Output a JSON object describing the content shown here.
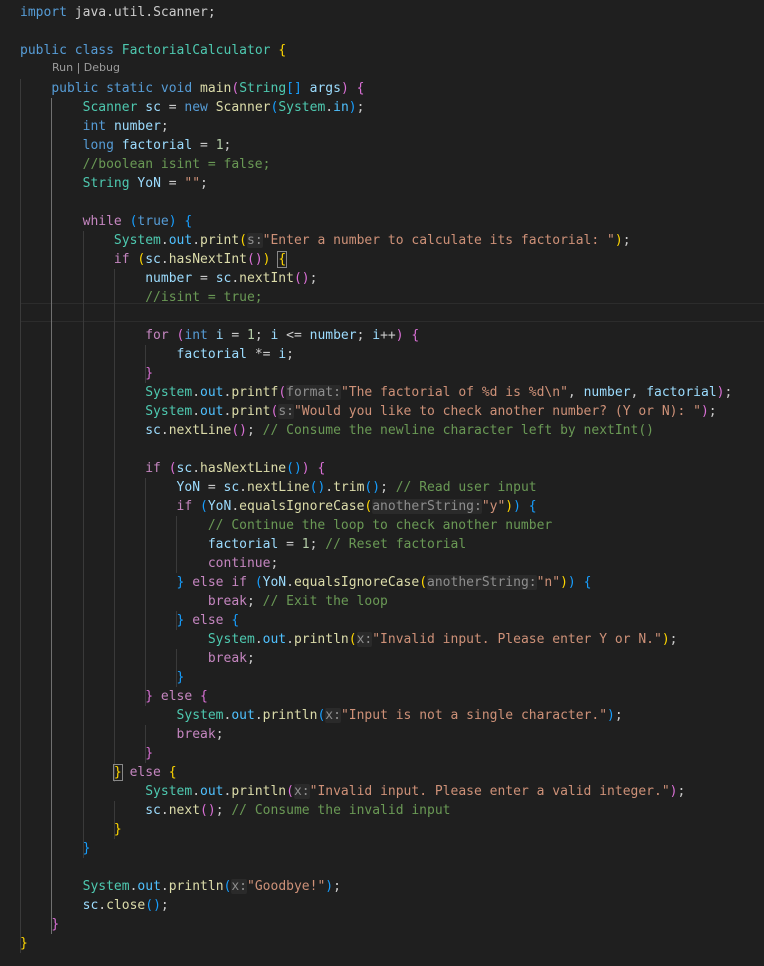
{
  "editor": {
    "language": "java",
    "theme_colors": {
      "background": "#1f1f1f",
      "keyword": "#569cd6",
      "control_keyword": "#c586c0",
      "type": "#4ec9b0",
      "function": "#dcdcaa",
      "variable": "#9cdcfe",
      "string": "#ce9178",
      "number": "#b5cea8",
      "comment": "#6a9955",
      "bracket_level_1": "#ffd700",
      "bracket_level_2": "#da70d6",
      "bracket_level_3": "#179fff"
    },
    "codelens": {
      "run": "Run",
      "separator": " | ",
      "debug": "Debug"
    },
    "lines": [
      [
        [
          "import ",
          "kw"
        ],
        [
          "java.util.Scanner",
          "plain"
        ],
        [
          ";",
          "plain"
        ]
      ],
      [],
      [
        [
          "public ",
          "kw"
        ],
        [
          "class ",
          "kw"
        ],
        [
          "FactorialCalculator",
          "ty"
        ],
        [
          " ",
          "plain"
        ],
        [
          "{",
          "b1"
        ]
      ],
      [
        [
          "    "
        ],
        [
          "public ",
          "kw"
        ],
        [
          "static ",
          "kw"
        ],
        [
          "void ",
          "kw"
        ],
        [
          "main",
          "fn"
        ],
        [
          "(",
          "b2"
        ],
        [
          "String",
          "ty"
        ],
        [
          "[]",
          "b3"
        ],
        [
          " args",
          "var"
        ],
        [
          ")",
          "b2"
        ],
        [
          " ",
          "plain"
        ],
        [
          "{",
          "b2"
        ]
      ],
      [
        [
          "        "
        ],
        [
          "Scanner",
          "ty"
        ],
        [
          " sc",
          "var"
        ],
        [
          " = ",
          "plain"
        ],
        [
          "new ",
          "kw"
        ],
        [
          "Scanner",
          "fn"
        ],
        [
          "(",
          "b3"
        ],
        [
          "System",
          "ty"
        ],
        [
          ".",
          "plain"
        ],
        [
          "in",
          "prop"
        ],
        [
          ")",
          "b3"
        ],
        [
          ";",
          "plain"
        ]
      ],
      [
        [
          "        "
        ],
        [
          "int ",
          "kw"
        ],
        [
          "number",
          "var"
        ],
        [
          ";",
          "plain"
        ]
      ],
      [
        [
          "        "
        ],
        [
          "long ",
          "kw"
        ],
        [
          "factorial",
          "var"
        ],
        [
          " = ",
          "plain"
        ],
        [
          "1",
          "num"
        ],
        [
          ";",
          "plain"
        ]
      ],
      [
        [
          "        "
        ],
        [
          "//boolean isint = false;",
          "com"
        ]
      ],
      [
        [
          "        "
        ],
        [
          "String",
          "ty"
        ],
        [
          " YoN",
          "var"
        ],
        [
          " = ",
          "plain"
        ],
        [
          "\"\"",
          "str"
        ],
        [
          ";",
          "plain"
        ]
      ],
      [],
      [
        [
          "        "
        ],
        [
          "while ",
          "ctl"
        ],
        [
          "(",
          "b3"
        ],
        [
          "true",
          "kw"
        ],
        [
          ")",
          "b3"
        ],
        [
          " ",
          "plain"
        ],
        [
          "{",
          "b3"
        ]
      ],
      [
        [
          "            "
        ],
        [
          "System",
          "ty"
        ],
        [
          ".",
          "plain"
        ],
        [
          "out",
          "prop"
        ],
        [
          ".",
          "plain"
        ],
        [
          "print",
          "fn"
        ],
        [
          "(",
          "b1"
        ],
        [
          "s:",
          "inlay"
        ],
        [
          "\"Enter a number to calculate its factorial: \"",
          "str"
        ],
        [
          ")",
          "b1"
        ],
        [
          ";",
          "plain"
        ]
      ],
      [
        [
          "            "
        ],
        [
          "if ",
          "ctl"
        ],
        [
          "(",
          "b1"
        ],
        [
          "sc",
          "var"
        ],
        [
          ".",
          "plain"
        ],
        [
          "hasNextInt",
          "fn"
        ],
        [
          "()",
          "b2"
        ],
        [
          ")",
          "b1"
        ],
        [
          " ",
          "plain"
        ],
        [
          "{",
          "b1 bm"
        ]
      ],
      [
        [
          "                "
        ],
        [
          "number",
          "var"
        ],
        [
          " = ",
          "plain"
        ],
        [
          "sc",
          "var"
        ],
        [
          ".",
          "plain"
        ],
        [
          "nextInt",
          "fn"
        ],
        [
          "()",
          "b2"
        ],
        [
          ";",
          "plain"
        ]
      ],
      [
        [
          "                "
        ],
        [
          "//isint = true;",
          "com"
        ]
      ],
      [],
      [
        [
          "                "
        ],
        [
          "for ",
          "ctl"
        ],
        [
          "(",
          "b2"
        ],
        [
          "int ",
          "kw"
        ],
        [
          "i",
          "var"
        ],
        [
          " = ",
          "plain"
        ],
        [
          "1",
          "num"
        ],
        [
          "; ",
          "plain"
        ],
        [
          "i",
          "var"
        ],
        [
          " <= ",
          "plain"
        ],
        [
          "number",
          "var"
        ],
        [
          "; ",
          "plain"
        ],
        [
          "i",
          "var"
        ],
        [
          "++",
          "plain"
        ],
        [
          ")",
          "b2"
        ],
        [
          " ",
          "plain"
        ],
        [
          "{",
          "b2"
        ]
      ],
      [
        [
          "                    "
        ],
        [
          "factorial",
          "var"
        ],
        [
          " *= ",
          "plain"
        ],
        [
          "i",
          "var"
        ],
        [
          ";",
          "plain"
        ]
      ],
      [
        [
          "                "
        ],
        [
          "}",
          "b2"
        ]
      ],
      [
        [
          "                "
        ],
        [
          "System",
          "ty"
        ],
        [
          ".",
          "plain"
        ],
        [
          "out",
          "prop"
        ],
        [
          ".",
          "plain"
        ],
        [
          "printf",
          "fn"
        ],
        [
          "(",
          "b2"
        ],
        [
          "format:",
          "inlay"
        ],
        [
          "\"The factorial of %d is %d\\n\"",
          "str"
        ],
        [
          ", ",
          "plain"
        ],
        [
          "number",
          "var"
        ],
        [
          ", ",
          "plain"
        ],
        [
          "factorial",
          "var"
        ],
        [
          ")",
          "b2"
        ],
        [
          ";",
          "plain"
        ]
      ],
      [
        [
          "                "
        ],
        [
          "System",
          "ty"
        ],
        [
          ".",
          "plain"
        ],
        [
          "out",
          "prop"
        ],
        [
          ".",
          "plain"
        ],
        [
          "print",
          "fn"
        ],
        [
          "(",
          "b2"
        ],
        [
          "s:",
          "inlay"
        ],
        [
          "\"Would you like to check another number? (Y or N): \"",
          "str"
        ],
        [
          ")",
          "b2"
        ],
        [
          ";",
          "plain"
        ]
      ],
      [
        [
          "                "
        ],
        [
          "sc",
          "var"
        ],
        [
          ".",
          "plain"
        ],
        [
          "nextLine",
          "fn"
        ],
        [
          "()",
          "b2"
        ],
        [
          ";",
          "plain"
        ],
        [
          " // Consume the newline character left by nextInt()",
          "com"
        ]
      ],
      [],
      [
        [
          "                "
        ],
        [
          "if ",
          "ctl"
        ],
        [
          "(",
          "b2"
        ],
        [
          "sc",
          "var"
        ],
        [
          ".",
          "plain"
        ],
        [
          "hasNextLine",
          "fn"
        ],
        [
          "()",
          "b3"
        ],
        [
          ")",
          "b2"
        ],
        [
          " ",
          "plain"
        ],
        [
          "{",
          "b2"
        ]
      ],
      [
        [
          "                    "
        ],
        [
          "YoN",
          "var"
        ],
        [
          " = ",
          "plain"
        ],
        [
          "sc",
          "var"
        ],
        [
          ".",
          "plain"
        ],
        [
          "nextLine",
          "fn"
        ],
        [
          "()",
          "b3"
        ],
        [
          ".",
          "plain"
        ],
        [
          "trim",
          "fn"
        ],
        [
          "()",
          "b3"
        ],
        [
          ";",
          "plain"
        ],
        [
          " // Read user input",
          "com"
        ]
      ],
      [
        [
          "                    "
        ],
        [
          "if ",
          "ctl"
        ],
        [
          "(",
          "b3"
        ],
        [
          "YoN",
          "var"
        ],
        [
          ".",
          "plain"
        ],
        [
          "equalsIgnoreCase",
          "fn"
        ],
        [
          "(",
          "b1"
        ],
        [
          "anotherString:",
          "inlay"
        ],
        [
          "\"y\"",
          "str"
        ],
        [
          ")",
          "b1"
        ],
        [
          ")",
          "b3"
        ],
        [
          " ",
          "plain"
        ],
        [
          "{",
          "b3"
        ]
      ],
      [
        [
          "                        "
        ],
        [
          "// Continue the loop to check another number",
          "com"
        ]
      ],
      [
        [
          "                        "
        ],
        [
          "factorial",
          "var"
        ],
        [
          " = ",
          "plain"
        ],
        [
          "1",
          "num"
        ],
        [
          ";",
          "plain"
        ],
        [
          " // Reset factorial",
          "com"
        ]
      ],
      [
        [
          "                        "
        ],
        [
          "continue",
          "ctl"
        ],
        [
          ";",
          "plain"
        ]
      ],
      [
        [
          "                    "
        ],
        [
          "}",
          "b3"
        ],
        [
          " ",
          "plain"
        ],
        [
          "else ",
          "ctl"
        ],
        [
          "if ",
          "ctl"
        ],
        [
          "(",
          "b3"
        ],
        [
          "YoN",
          "var"
        ],
        [
          ".",
          "plain"
        ],
        [
          "equalsIgnoreCase",
          "fn"
        ],
        [
          "(",
          "b1"
        ],
        [
          "anotherString:",
          "inlay"
        ],
        [
          "\"n\"",
          "str"
        ],
        [
          ")",
          "b1"
        ],
        [
          ")",
          "b3"
        ],
        [
          " ",
          "plain"
        ],
        [
          "{",
          "b3"
        ]
      ],
      [
        [
          "                        "
        ],
        [
          "break",
          "ctl"
        ],
        [
          ";",
          "plain"
        ],
        [
          " // Exit the loop",
          "com"
        ]
      ],
      [
        [
          "                    "
        ],
        [
          "}",
          "b3"
        ],
        [
          " ",
          "plain"
        ],
        [
          "else ",
          "ctl"
        ],
        [
          "{",
          "b3"
        ]
      ],
      [
        [
          "                        "
        ],
        [
          "System",
          "ty"
        ],
        [
          ".",
          "plain"
        ],
        [
          "out",
          "prop"
        ],
        [
          ".",
          "plain"
        ],
        [
          "println",
          "fn"
        ],
        [
          "(",
          "b1"
        ],
        [
          "x:",
          "inlay"
        ],
        [
          "\"Invalid input. Please enter Y or N.\"",
          "str"
        ],
        [
          ")",
          "b1"
        ],
        [
          ";",
          "plain"
        ]
      ],
      [
        [
          "                        "
        ],
        [
          "break",
          "ctl"
        ],
        [
          ";",
          "plain"
        ]
      ],
      [
        [
          "                    "
        ],
        [
          "}",
          "b3"
        ]
      ],
      [
        [
          "                "
        ],
        [
          "}",
          "b2"
        ],
        [
          " ",
          "plain"
        ],
        [
          "else ",
          "ctl"
        ],
        [
          "{",
          "b2"
        ]
      ],
      [
        [
          "                    "
        ],
        [
          "System",
          "ty"
        ],
        [
          ".",
          "plain"
        ],
        [
          "out",
          "prop"
        ],
        [
          ".",
          "plain"
        ],
        [
          "println",
          "fn"
        ],
        [
          "(",
          "b3"
        ],
        [
          "x:",
          "inlay"
        ],
        [
          "\"Input is not a single character.\"",
          "str"
        ],
        [
          ")",
          "b3"
        ],
        [
          ";",
          "plain"
        ]
      ],
      [
        [
          "                    "
        ],
        [
          "break",
          "ctl"
        ],
        [
          ";",
          "plain"
        ]
      ],
      [
        [
          "                "
        ],
        [
          "}",
          "b2"
        ]
      ],
      [
        [
          "            "
        ],
        [
          "}",
          "b1 bm"
        ],
        [
          " ",
          "plain"
        ],
        [
          "else ",
          "ctl"
        ],
        [
          "{",
          "b1"
        ]
      ],
      [
        [
          "                "
        ],
        [
          "System",
          "ty"
        ],
        [
          ".",
          "plain"
        ],
        [
          "out",
          "prop"
        ],
        [
          ".",
          "plain"
        ],
        [
          "println",
          "fn"
        ],
        [
          "(",
          "b2"
        ],
        [
          "x:",
          "inlay"
        ],
        [
          "\"Invalid input. Please enter a valid integer.\"",
          "str"
        ],
        [
          ")",
          "b2"
        ],
        [
          ";",
          "plain"
        ]
      ],
      [
        [
          "                "
        ],
        [
          "sc",
          "var"
        ],
        [
          ".",
          "plain"
        ],
        [
          "next",
          "fn"
        ],
        [
          "()",
          "b2"
        ],
        [
          ";",
          "plain"
        ],
        [
          " // Consume the invalid input",
          "com"
        ]
      ],
      [
        [
          "            "
        ],
        [
          "}",
          "b1"
        ]
      ],
      [
        [
          "        "
        ],
        [
          "}",
          "b3"
        ]
      ],
      [],
      [
        [
          "        "
        ],
        [
          "System",
          "ty"
        ],
        [
          ".",
          "plain"
        ],
        [
          "out",
          "prop"
        ],
        [
          ".",
          "plain"
        ],
        [
          "println",
          "fn"
        ],
        [
          "(",
          "b3"
        ],
        [
          "x:",
          "inlay"
        ],
        [
          "\"Goodbye!\"",
          "str"
        ],
        [
          ")",
          "b3"
        ],
        [
          ";",
          "plain"
        ]
      ],
      [
        [
          "        "
        ],
        [
          "sc",
          "var"
        ],
        [
          ".",
          "plain"
        ],
        [
          "close",
          "fn"
        ],
        [
          "()",
          "b3"
        ],
        [
          ";",
          "plain"
        ]
      ],
      [
        [
          "    "
        ],
        [
          "}",
          "b2"
        ]
      ],
      [
        [
          "}",
          "b1"
        ]
      ]
    ]
  }
}
